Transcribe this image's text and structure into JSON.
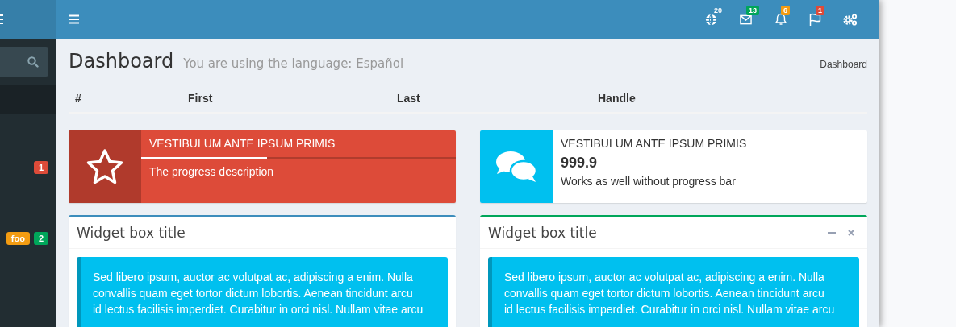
{
  "sidebar": {
    "items": [
      {
        "badges": [
          {
            "text": "1",
            "color": "#dd4b39"
          }
        ]
      },
      {
        "badges": [
          {
            "text": "foo",
            "color": "#f39c12"
          },
          {
            "text": "2",
            "color": "#00a65a"
          }
        ]
      }
    ]
  },
  "navbar": {
    "notifications": [
      {
        "kind": "globe",
        "count": "20"
      },
      {
        "kind": "envelope",
        "count": "13",
        "color": "#00a65a"
      },
      {
        "kind": "bell",
        "count": "6",
        "color": "#f39c12"
      },
      {
        "kind": "flag",
        "count": "1",
        "color": "#dd4b39"
      },
      {
        "kind": "gears"
      }
    ]
  },
  "page_header": {
    "title": "Dashboard",
    "subtitle": "You are using the language: Español",
    "breadcrumb": [
      "Dashboard"
    ]
  },
  "table": {
    "columns": [
      "#",
      "First",
      "Last",
      "Handle"
    ]
  },
  "info_boxes": [
    {
      "kind": "progress",
      "color": "#dd4b39",
      "filled": true,
      "title": "VESTIBULUM ANTE IPSUM PRIMIS",
      "description": "The progress description",
      "level": 0.4
    },
    {
      "kind": "number",
      "color": "#00c0ef",
      "filled": false,
      "title": "VESTIBULUM ANTE IPSUM PRIMIS",
      "number": "999.9",
      "description": "Works as well without progress bar"
    }
  ],
  "widgets": [
    {
      "title": "Widget box title",
      "color": "#3c8dbc",
      "collapsible": false,
      "removable": false,
      "text": "Sed libero ipsum, auctor ac volutpat ac, adipiscing a enim. Nulla convallis quam eget tortor dictum lobortis. Aenean tincidunt arcu id lectus facilisis imperdiet. Curabitur in orci nisl. Nullam vitae arcu"
    },
    {
      "title": "Widget box title",
      "color": "#00a65a",
      "collapsible": true,
      "removable": true,
      "text": "Sed libero ipsum, auctor ac volutpat ac, adipiscing a enim. Nulla convallis quam eget tortor dictum lobortis. Aenean tincidunt arcu id lectus facilisis imperdiet. Curabitur in orci nisl. Nullam vitae arcu"
    }
  ]
}
